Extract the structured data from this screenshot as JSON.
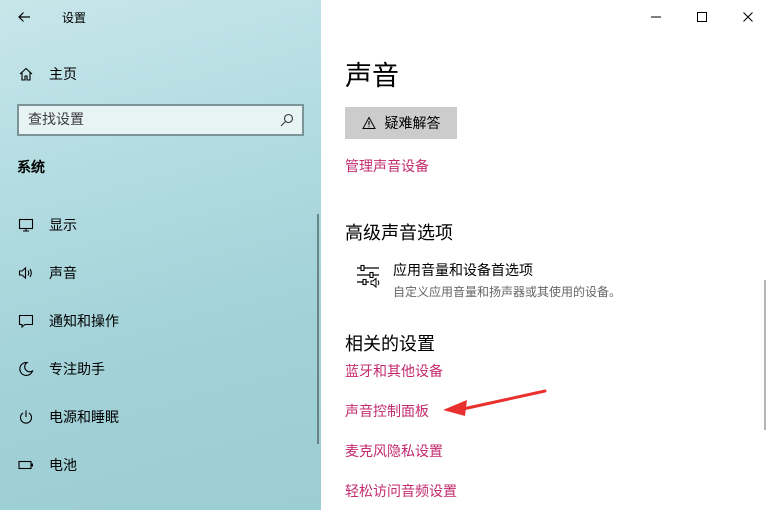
{
  "window": {
    "app_title": "设置"
  },
  "sidebar": {
    "home_label": "主页",
    "search_placeholder": "查找设置",
    "section_title": "系统",
    "items": [
      {
        "label": "显示",
        "icon": "monitor-icon"
      },
      {
        "label": "声音",
        "icon": "speaker-icon",
        "active": true
      },
      {
        "label": "通知和操作",
        "icon": "notification-icon"
      },
      {
        "label": "专注助手",
        "icon": "moon-icon"
      },
      {
        "label": "电源和睡眠",
        "icon": "power-icon"
      },
      {
        "label": "电池",
        "icon": "battery-icon"
      }
    ]
  },
  "main": {
    "title": "声音",
    "troubleshoot_label": "疑难解答",
    "manage_devices_link": "管理声音设备",
    "advanced": {
      "heading": "高级声音选项",
      "app_volume": {
        "title": "应用音量和设备首选项",
        "description": "自定义应用音量和扬声器或其使用的设备。"
      }
    },
    "related": {
      "heading": "相关的设置",
      "links": [
        "蓝牙和其他设备",
        "声音控制面板",
        "麦克风隐私设置",
        "轻松访问音频设置"
      ]
    }
  },
  "colors": {
    "accent": "#c32b6e",
    "annotation": "#e8312f"
  }
}
